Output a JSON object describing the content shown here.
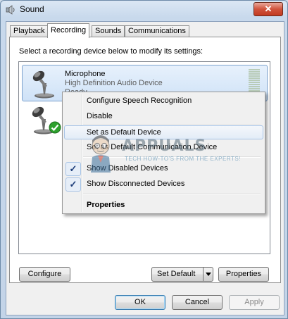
{
  "window": {
    "title": "Sound",
    "close_symbol": "✕"
  },
  "tabs": [
    "Playback",
    "Recording",
    "Sounds",
    "Communications"
  ],
  "active_tab": "Recording",
  "instruction": "Select a recording device below to modify its settings:",
  "devices": [
    {
      "name": "Microphone",
      "description": "High Definition Audio Device",
      "status": "Ready",
      "icon": "microphone-icon",
      "selected": true
    },
    {
      "name": "",
      "description": "",
      "status": "",
      "icon": "microphone-default-icon",
      "default_badge": "green-check"
    }
  ],
  "context_menu": {
    "items": [
      {
        "label": "Configure Speech Recognition",
        "checked": false
      },
      {
        "label": "Disable",
        "checked": false
      },
      {
        "label": "Set as Default Device",
        "checked": false,
        "highlighted": true
      },
      {
        "label": "Set as Default Communication Device",
        "checked": false
      },
      {
        "label": "Show Disabled Devices",
        "checked": true
      },
      {
        "label": "Show Disconnected Devices",
        "checked": true
      },
      {
        "label": "Properties",
        "checked": false,
        "bold": true
      }
    ],
    "check_symbol": "✓"
  },
  "panel_buttons": {
    "configure": "Configure",
    "set_default": "Set Default",
    "properties": "Properties"
  },
  "dialog_buttons": {
    "ok": "OK",
    "cancel": "Cancel",
    "apply": "Apply"
  },
  "watermark": {
    "brand": "APPUALS",
    "tagline": "TECH HOW-TO'S FROM THE EXPERTS!"
  },
  "colors": {
    "accent": "#3c7fb1",
    "selection": "#cfe2f7",
    "check_green": "#2ea12e"
  }
}
